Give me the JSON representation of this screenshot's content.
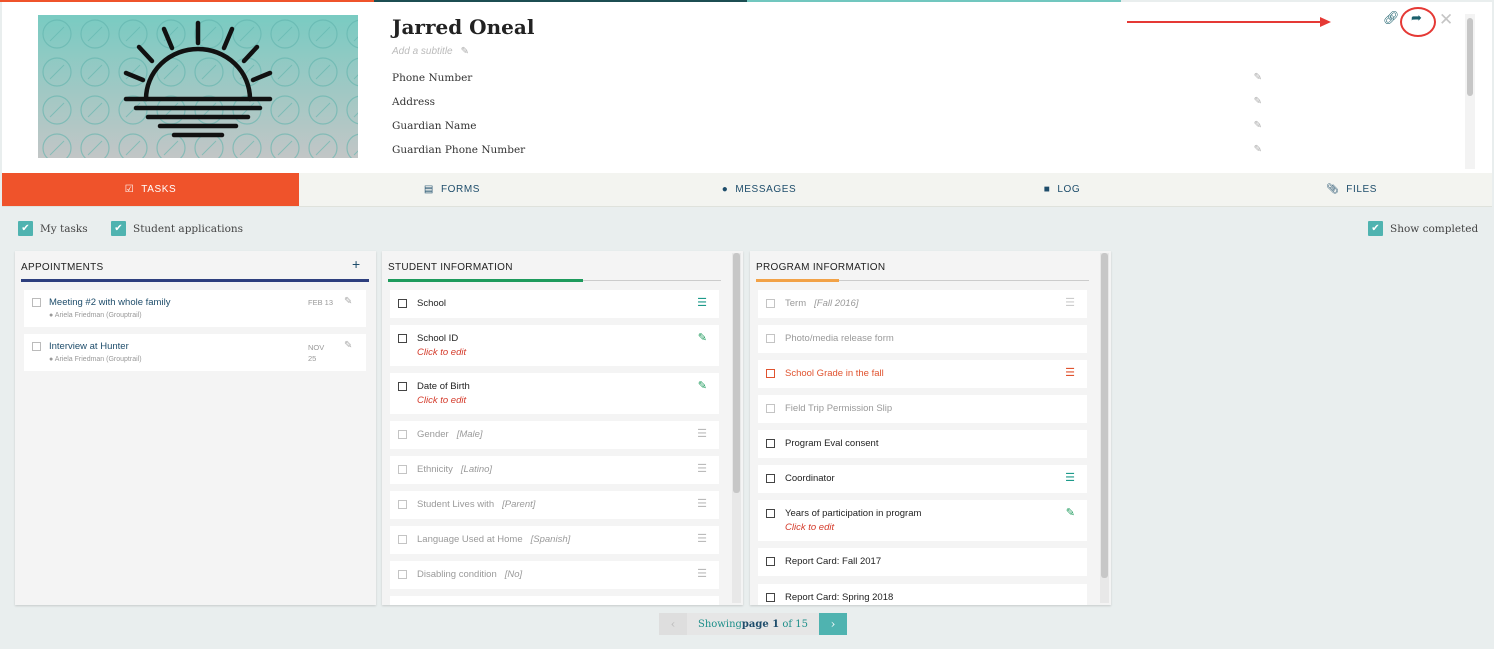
{
  "profile": {
    "name": "Jarred Oneal",
    "subtitle_placeholder": "Add a subtitle",
    "fields": [
      "Phone Number",
      "Address",
      "Guardian Name",
      "Guardian Phone Number"
    ]
  },
  "header_icons": [
    "link-icon",
    "share-icon",
    "close-icon"
  ],
  "tabs": [
    {
      "label": "TASKS",
      "icon": "checkbox-edit-icon",
      "active": true
    },
    {
      "label": "FORMS",
      "icon": "form-icon",
      "active": false
    },
    {
      "label": "MESSAGES",
      "icon": "chat-icon",
      "active": false
    },
    {
      "label": "LOG",
      "icon": "book-icon",
      "active": false
    },
    {
      "label": "FILES",
      "icon": "paperclip-icon",
      "active": false
    }
  ],
  "filters": {
    "my_tasks": "My tasks",
    "student_applications": "Student applications",
    "show_completed": "Show completed"
  },
  "appointments": {
    "title": "APPOINTMENTS",
    "add_label": "+",
    "items": [
      {
        "title": "Meeting #2 with whole family",
        "person": "Ariela Friedman (Grouptrail)",
        "date": "FEB 13"
      },
      {
        "title": "Interview at Hunter",
        "person": "Ariela Friedman (Grouptrail)",
        "date": "NOV\n25"
      }
    ]
  },
  "student_information": {
    "title": "STUDENT INFORMATION",
    "items": [
      {
        "label": "School",
        "value": "",
        "state": "todo",
        "icon": "menu"
      },
      {
        "label": "School ID",
        "value": "",
        "state": "todo",
        "icon": "pencil",
        "click_to_edit": "Click to edit"
      },
      {
        "label": "Date of Birth",
        "value": "",
        "state": "todo",
        "icon": "pencil",
        "click_to_edit": "Click to edit"
      },
      {
        "label": "Gender",
        "value": "[Male]",
        "state": "done",
        "icon": "menu"
      },
      {
        "label": "Ethnicity",
        "value": "[Latino]",
        "state": "done",
        "icon": "menu"
      },
      {
        "label": "Student Lives with",
        "value": "[Parent]",
        "state": "done",
        "icon": "menu"
      },
      {
        "label": "Language Used at Home",
        "value": "[Spanish]",
        "state": "done",
        "icon": "menu"
      },
      {
        "label": "Disabling condition",
        "value": "[No]",
        "state": "done",
        "icon": "menu"
      }
    ]
  },
  "program_information": {
    "title": "PROGRAM INFORMATION",
    "items": [
      {
        "label": "Term",
        "value": "[Fall 2016]",
        "state": "done",
        "icon": "menu"
      },
      {
        "label": "Photo/media release form",
        "value": "",
        "state": "done",
        "icon": ""
      },
      {
        "label": "School Grade in the fall",
        "value": "",
        "state": "alert",
        "icon": "menu"
      },
      {
        "label": "Field Trip Permission Slip",
        "value": "",
        "state": "done",
        "icon": ""
      },
      {
        "label": "Program Eval consent",
        "value": "",
        "state": "todo",
        "icon": ""
      },
      {
        "label": "Coordinator",
        "value": "",
        "state": "todo",
        "icon": "menu"
      },
      {
        "label": "Years of participation in program",
        "value": "",
        "state": "todo",
        "icon": "pencil",
        "click_to_edit": "Click to edit"
      },
      {
        "label": "Report Card: Fall 2017",
        "value": "",
        "state": "todo",
        "icon": ""
      },
      {
        "label": "Report Card: Spring 2018",
        "value": "",
        "state": "todo",
        "icon": ""
      }
    ]
  },
  "pagination": {
    "prefix": "Showing ",
    "page_word": "page ",
    "current": "1",
    "of": " of ",
    "total": "15"
  },
  "colors": {
    "tab_active": "#ef532b",
    "teal": "#4fb3b0",
    "appointments_bar": "#2e3f7e",
    "student_bar": "#1d9a5c",
    "program_bar": "#f2a247",
    "annotation_red": "#e53935"
  }
}
